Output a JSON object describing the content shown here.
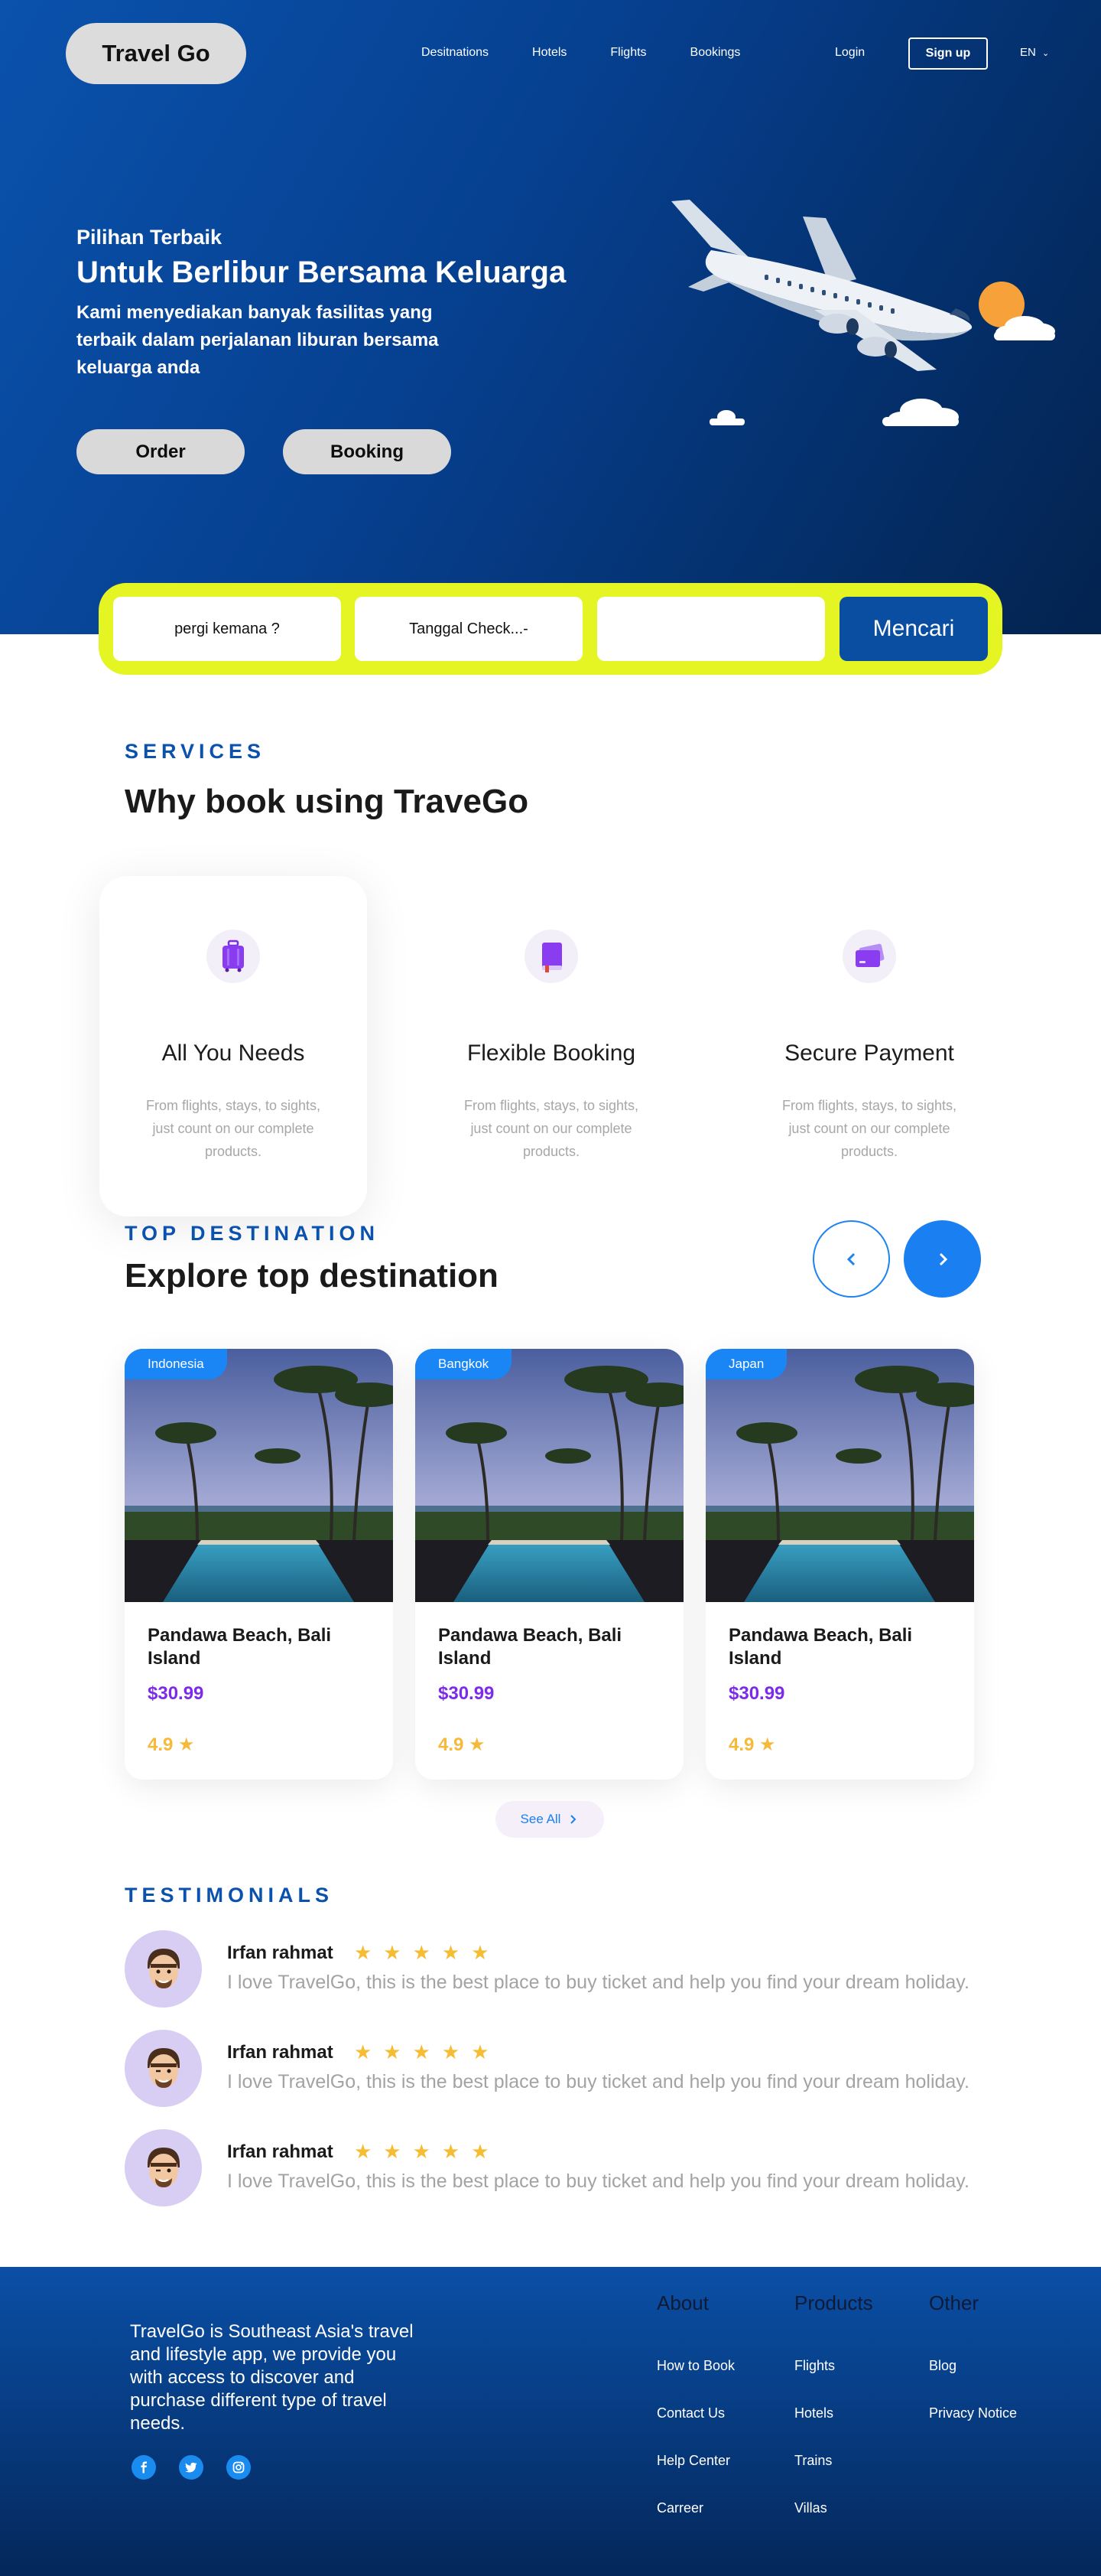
{
  "nav": {
    "logo": "Travel Go",
    "links": [
      "Desitnations",
      "Hotels",
      "Flights",
      "Bookings"
    ],
    "login": "Login",
    "signup": "Sign up",
    "lang": "EN"
  },
  "hero": {
    "kicker": "Pilihan Terbaik",
    "title": "Untuk Berlibur Bersama Keluarga",
    "desc": "Kami menyediakan banyak fasilitas yang terbaik dalam perjalanan liburan bersama keluarga anda",
    "order": "Order",
    "booking": "Booking"
  },
  "search": {
    "destination": "pergi kemana ?",
    "checkin": "Tanggal Check...-",
    "empty": "",
    "button": "Mencari"
  },
  "services": {
    "kicker": "SERVICES",
    "title": "Why book using TraveGo",
    "items": [
      {
        "title": "All You Needs",
        "desc": "From flights, stays, to sights, just count on our complete products.",
        "icon": "suitcase-icon"
      },
      {
        "title": "Flexible Booking",
        "desc": "From flights, stays, to sights, just count on our complete products.",
        "icon": "book-icon"
      },
      {
        "title": "Secure Payment",
        "desc": "From flights, stays, to sights, just count on our complete products.",
        "icon": "credit-card-icon"
      }
    ]
  },
  "destinations": {
    "kicker": "TOP DESTINATION",
    "title": "Explore top destination",
    "see_all": "See All",
    "cards": [
      {
        "tag": "Indonesia",
        "name": "Pandawa Beach, Bali Island",
        "price": "$30.99",
        "rating": "4.9"
      },
      {
        "tag": "Bangkok",
        "name": "Pandawa Beach, Bali Island",
        "price": "$30.99",
        "rating": "4.9"
      },
      {
        "tag": "Japan",
        "name": "Pandawa Beach, Bali Island",
        "price": "$30.99",
        "rating": "4.9"
      }
    ]
  },
  "testimonials": {
    "kicker": "TESTIMONIALS",
    "items": [
      {
        "name": "Irfan rahmat",
        "stars": "★★★★★",
        "text": "I love TravelGo, this is the best place to buy ticket and help you find your dream holiday."
      },
      {
        "name": "Irfan rahmat",
        "stars": "★★★★★",
        "text": "I love TravelGo, this is the best place to buy ticket and help you find your dream holiday."
      },
      {
        "name": "Irfan rahmat",
        "stars": "★★★★★",
        "text": "I love TravelGo, this is the best place to buy ticket and help you find your dream holiday."
      }
    ]
  },
  "footer": {
    "about": "TravelGo is Southeast Asia's travel and lifestyle app, we provide you with access to discover and purchase different type of travel needs.",
    "cols": [
      {
        "title": "About",
        "links": [
          "How to Book",
          "Contact Us",
          "Help Center",
          "Carreer"
        ]
      },
      {
        "title": "Products",
        "links": [
          "Flights",
          "Hotels",
          "Trains",
          "Villas"
        ]
      },
      {
        "title": "Other",
        "links": [
          "Blog",
          "Privacy Notice"
        ]
      }
    ]
  },
  "colors": {
    "brand_blue": "#0a52ad",
    "search_bar": "#e5f523",
    "accent_blue": "#1a7ff0",
    "price_purple": "#7c2bea",
    "star_yellow": "#f6bd33"
  }
}
